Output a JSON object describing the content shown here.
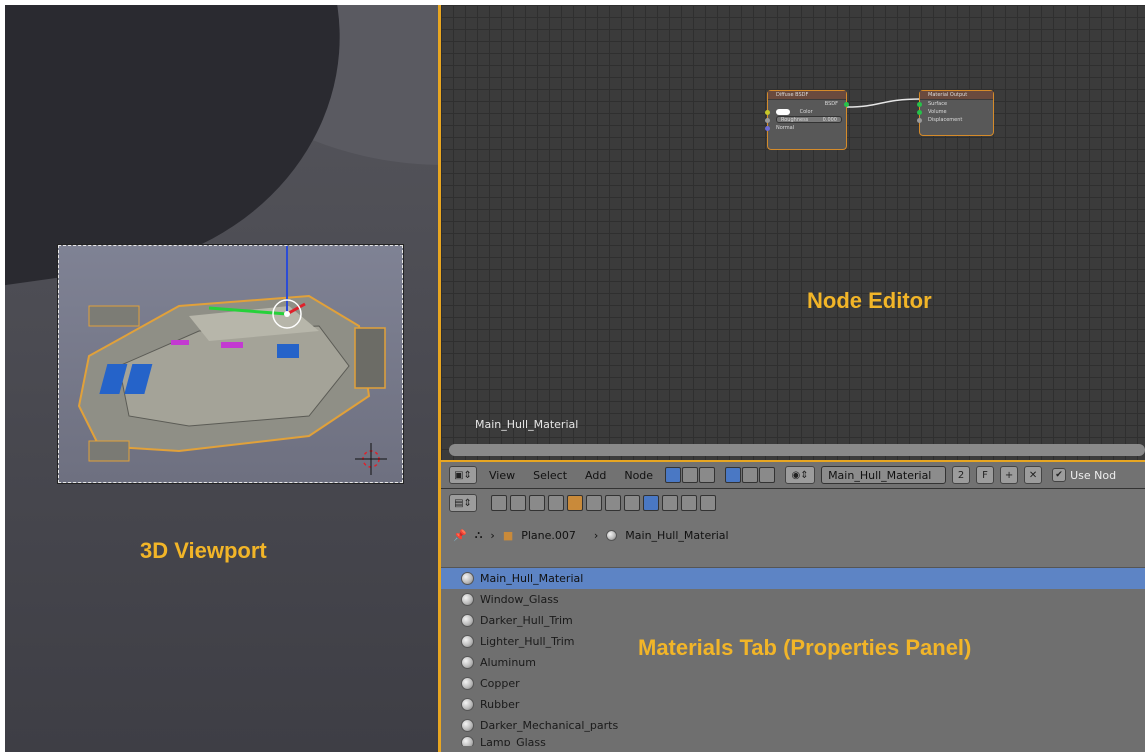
{
  "viewport": {
    "label": "3D Viewport"
  },
  "node_editor": {
    "label": "Node Editor",
    "material_name": "Main_Hull_Material",
    "nodes": {
      "bsdf": {
        "title": "Diffuse BSDF",
        "output": "BSDF",
        "inputs": [
          "Color",
          "Roughness",
          "Normal"
        ],
        "roughness_value": "0.000"
      },
      "output": {
        "title": "Material Output",
        "inputs": [
          "Surface",
          "Volume",
          "Displacement"
        ]
      }
    }
  },
  "header": {
    "menus": [
      "View",
      "Select",
      "Add",
      "Node"
    ],
    "material_field": "Main_Hull_Material",
    "user_count": "2",
    "fake_user": "F",
    "use_nodes_label": "Use Nod"
  },
  "properties": {
    "breadcrumb": {
      "object": "Plane.007",
      "material": "Main_Hull_Material"
    },
    "label": "Materials Tab (Properties  Panel)",
    "materials": [
      "Main_Hull_Material",
      "Window_Glass",
      "Darker_Hull_Trim",
      "Lighter_Hull_Trim",
      "Aluminum",
      "Copper",
      "Rubber",
      "Darker_Mechanical_parts",
      "Lamp_Glass"
    ]
  },
  "colors": {
    "accent_label": "#f2b528",
    "divider": "#e8a621",
    "selection": "#5d84c5"
  }
}
